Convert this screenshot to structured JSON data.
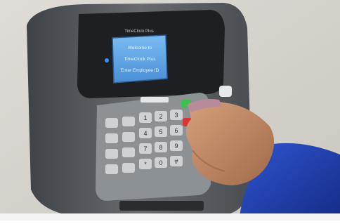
{
  "device": {
    "brand": "TimeClock Plus",
    "screen_lines": [
      "Welcome to",
      "TimeClock Plus",
      "Enter Employee ID"
    ]
  },
  "keypad": {
    "rows": [
      [
        "1",
        "2",
        "3"
      ],
      [
        "4",
        "5",
        "6"
      ],
      [
        "7",
        "8",
        "9"
      ],
      [
        "*",
        "0",
        "#"
      ]
    ]
  },
  "colors": {
    "wall": "#d9d6d0",
    "housing": "#5a5e62",
    "screen": "#5aa3e6",
    "keys": "#cfd2d4",
    "sleeve": "#1e3da8",
    "skin": "#c08a68"
  }
}
